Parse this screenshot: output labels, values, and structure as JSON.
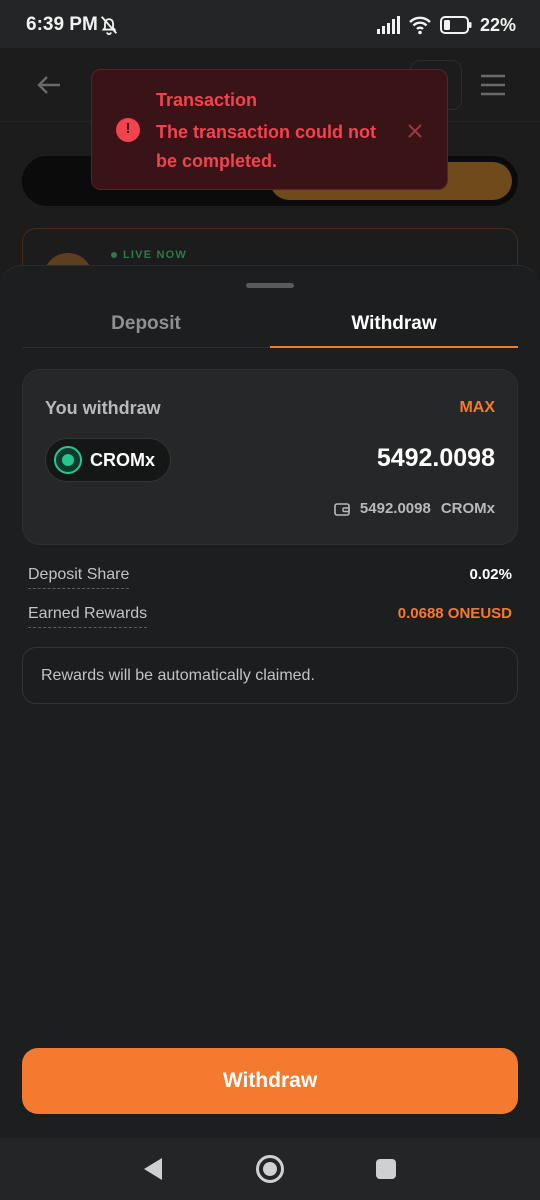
{
  "status_bar": {
    "time": "6:39 PM",
    "battery": "22%"
  },
  "background": {
    "live_badge": "LIVE NOW"
  },
  "toast": {
    "title": "Transaction",
    "message": "The transaction could not be completed.",
    "color": "#f3434f"
  },
  "sheet": {
    "tabs": [
      {
        "label": "Deposit",
        "active": false
      },
      {
        "label": "Withdraw",
        "active": true
      }
    ],
    "card": {
      "title": "You withdraw",
      "max_label": "MAX",
      "token": "CROMx",
      "amount": "5492.0098",
      "balance": "5492.0098",
      "balance_token": "CROMx"
    },
    "info": [
      {
        "label": "Deposit Share",
        "value": "0.02%",
        "color": "#ffffff"
      },
      {
        "label": "Earned Rewards",
        "value": "0.0688 ONEUSD",
        "color": "#f47a2f"
      }
    ],
    "notice": "Rewards will be automatically claimed.",
    "submit_label": "Withdraw"
  },
  "colors": {
    "accent": "#f47a2f",
    "error": "#f3434f",
    "sheet_bg": "#1d1e1f"
  }
}
